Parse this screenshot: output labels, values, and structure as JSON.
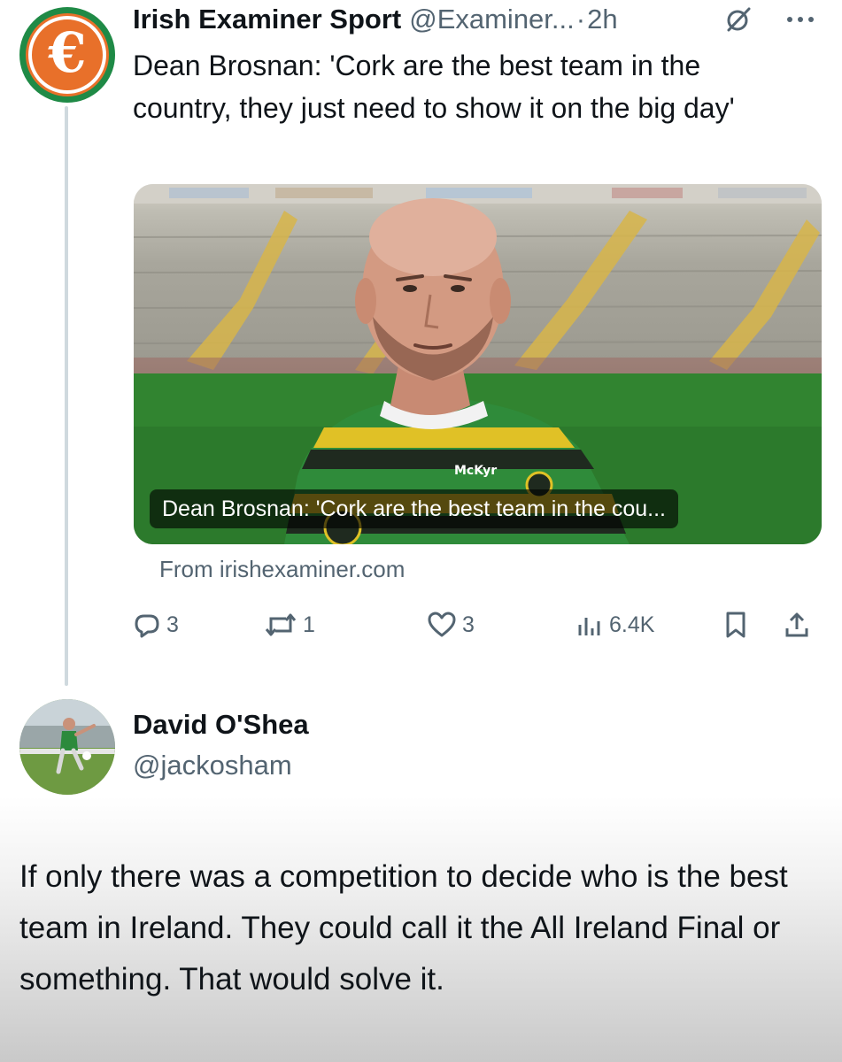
{
  "post": {
    "display_name": "Irish Examiner Sport",
    "handle": "@Examiner...",
    "separator": "·",
    "time": "2h",
    "text": "Dean Brosnan: 'Cork are the best team in the country, they just need to show it on the big day'",
    "avatar_glyph": "€",
    "card": {
      "caption": "Dean Brosnan: 'Cork are the best team in the cou...",
      "source": "From irishexaminer.com",
      "shirt_sponsor": "McKyr"
    },
    "actions": {
      "replies": "3",
      "reposts": "1",
      "likes": "3",
      "views": "6.4K"
    }
  },
  "reply": {
    "display_name": "David O'Shea",
    "handle": "@jackosham",
    "text": "If only there was a competition to decide who is the best team in Ireland. They could call it the All Ireland Final or something. That would solve it."
  },
  "icons": [
    "grok-icon",
    "more-icon",
    "reply-icon",
    "repost-icon",
    "like-icon",
    "views-icon",
    "bookmark-icon",
    "share-icon"
  ],
  "colors": {
    "text_primary": "#0f1419",
    "text_secondary": "#536471",
    "logo_orange": "#e8702a",
    "logo_green": "#1f8a46",
    "thread_line": "#cfd9de"
  }
}
